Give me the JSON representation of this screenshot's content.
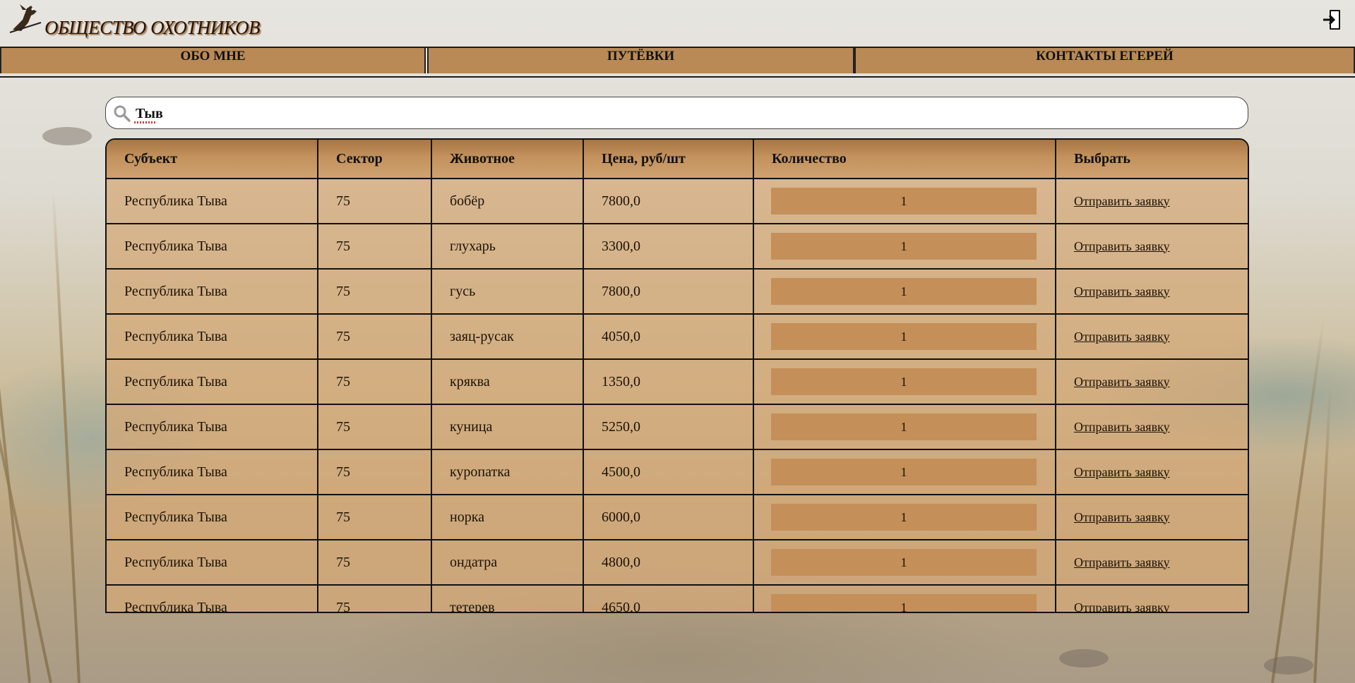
{
  "site": {
    "title": "ОБЩЕСТВО ОХОТНИКОВ"
  },
  "header": {
    "logo_icon": "hunting-dog-logo-icon",
    "logout_icon": "logout-icon"
  },
  "nav": {
    "items": [
      "ОБО МНЕ",
      "ПУТЁВКИ",
      "КОНТАКТЫ ЕГЕРЕЙ"
    ]
  },
  "search": {
    "icon": "search-icon",
    "value": "Тыв",
    "placeholder": ""
  },
  "table": {
    "headers": [
      "Субъект",
      "Сектор",
      "Животное",
      "Цена, руб/шт",
      "Количество",
      "Выбрать"
    ],
    "rows": [
      {
        "subject": "Республика Тыва",
        "sector": "75",
        "animal": "бобёр",
        "price": "7800,0",
        "quantity": "1",
        "action": "Отправить заявку"
      },
      {
        "subject": "Республика Тыва",
        "sector": "75",
        "animal": "глухарь",
        "price": "3300,0",
        "quantity": "1",
        "action": "Отправить заявку"
      },
      {
        "subject": "Республика Тыва",
        "sector": "75",
        "animal": "гусь",
        "price": "7800,0",
        "quantity": "1",
        "action": "Отправить заявку"
      },
      {
        "subject": "Республика Тыва",
        "sector": "75",
        "animal": "заяц-русак",
        "price": "4050,0",
        "quantity": "1",
        "action": "Отправить заявку"
      },
      {
        "subject": "Республика Тыва",
        "sector": "75",
        "animal": "кряква",
        "price": "1350,0",
        "quantity": "1",
        "action": "Отправить заявку"
      },
      {
        "subject": "Республика Тыва",
        "sector": "75",
        "animal": "куница",
        "price": "5250,0",
        "quantity": "1",
        "action": "Отправить заявку"
      },
      {
        "subject": "Республика Тыва",
        "sector": "75",
        "animal": "куропатка",
        "price": "4500,0",
        "quantity": "1",
        "action": "Отправить заявку"
      },
      {
        "subject": "Республика Тыва",
        "sector": "75",
        "animal": "норка",
        "price": "6000,0",
        "quantity": "1",
        "action": "Отправить заявку"
      },
      {
        "subject": "Республика Тыва",
        "sector": "75",
        "animal": "ондатра",
        "price": "4800,0",
        "quantity": "1",
        "action": "Отправить заявку"
      },
      {
        "subject": "Республика Тыва",
        "sector": "75",
        "animal": "тетерев",
        "price": "4650,0",
        "quantity": "1",
        "action": "Отправить заявку"
      }
    ]
  },
  "colors": {
    "nav_bg": "#b98a56",
    "header_row_bg": "#c3925d",
    "row_bg": "#d4a776",
    "quantity_bg": "#c48f58",
    "title_text": "#2a1508"
  }
}
